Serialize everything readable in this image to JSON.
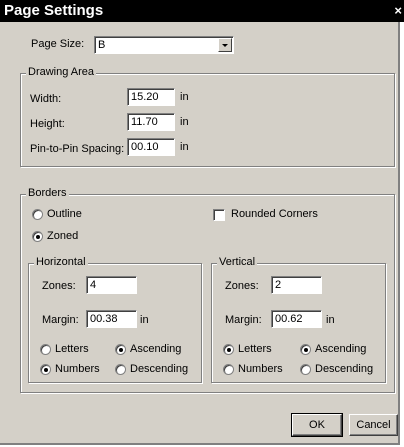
{
  "window": {
    "title": "Page Settings",
    "close_glyph": "×"
  },
  "page_size": {
    "label": "Page Size:",
    "value": "B"
  },
  "drawing_area": {
    "legend": "Drawing Area",
    "width": {
      "label": "Width:",
      "value": "15.20",
      "unit": "in"
    },
    "height": {
      "label": "Height:",
      "value": "11.70",
      "unit": "in"
    },
    "spacing": {
      "label": "Pin-to-Pin Spacing:",
      "value": "00.10",
      "unit": "in"
    }
  },
  "borders": {
    "legend": "Borders",
    "outline": {
      "label": "Outline",
      "checked": false
    },
    "zoned": {
      "label": "Zoned",
      "checked": true
    },
    "rounded": {
      "label": "Rounded Corners",
      "checked": false
    }
  },
  "horizontal": {
    "legend": "Horizontal",
    "zones_label": "Zones:",
    "zones_value": "4",
    "margin_label": "Margin:",
    "margin_value": "00.38",
    "margin_unit": "in",
    "letters": "Letters",
    "numbers": "Numbers",
    "ascending": "Ascending",
    "descending": "Descending",
    "selected_label": "Numbers",
    "selected_order": "Ascending"
  },
  "vertical": {
    "legend": "Vertical",
    "zones_label": "Zones:",
    "zones_value": "2",
    "margin_label": "Margin:",
    "margin_value": "00.62",
    "margin_unit": "in",
    "letters": "Letters",
    "numbers": "Numbers",
    "ascending": "Ascending",
    "descending": "Descending",
    "selected_label": "Letters",
    "selected_order": "Ascending"
  },
  "buttons": {
    "ok": "OK",
    "cancel": "Cancel"
  }
}
